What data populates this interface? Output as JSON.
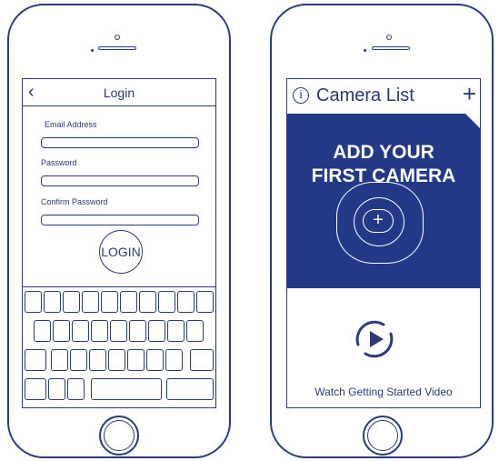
{
  "login_screen": {
    "header_title": "Login",
    "fields": [
      {
        "label": "Email Address",
        "value": ""
      },
      {
        "label": "Password",
        "value": ""
      },
      {
        "label": "Confirm Password",
        "value": ""
      }
    ],
    "login_button": "LOGIN"
  },
  "camera_screen": {
    "info_glyph": "i",
    "title": "Camera List",
    "add_glyph": "+",
    "banner_line1": "ADD YOUR",
    "banner_line2": "FIRST CAMERA",
    "banner_plus": "+",
    "video_label": "Watch Getting Started Video"
  },
  "colors": {
    "outline": "#2b3a78",
    "banner": "#233887"
  }
}
